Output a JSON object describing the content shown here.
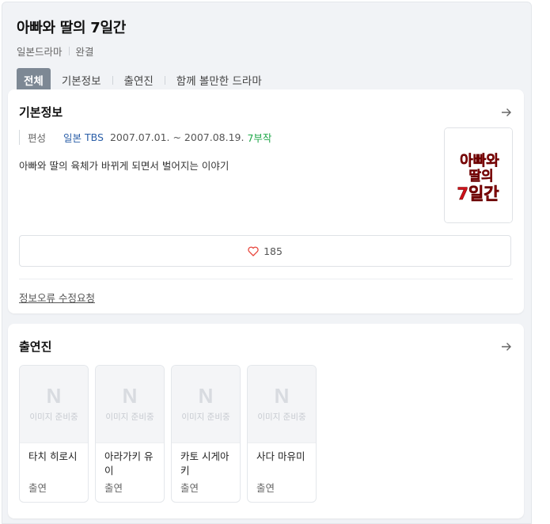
{
  "drama": {
    "title": "아빠와 딸의 7일간",
    "genre": "일본드라마",
    "status": "완결"
  },
  "tabs": [
    "전체",
    "기본정보",
    "출연진",
    "함께 볼만한 드라마"
  ],
  "basic_info": {
    "heading": "기본정보",
    "label": "편성",
    "country": "일본",
    "channel": "TBS",
    "dates": "2007.07.01. ~ 2007.08.19.",
    "episodes": "7부작",
    "description": "아빠와 딸의 육체가 바뀌게 되면서 벌어지는 이야기",
    "poster_text": [
      "아빠와",
      "딸의",
      "7일간"
    ],
    "likes": "185",
    "report_link": "정보오류 수정요청"
  },
  "cast": {
    "heading": "출연진",
    "placeholder_logo": "N",
    "placeholder_text": "이미지 준비중",
    "members": [
      {
        "name": "타치 히로시",
        "role": "출연"
      },
      {
        "name": "아라가키 유이",
        "role": "출연"
      },
      {
        "name": "카토 시게아키",
        "role": "출연"
      },
      {
        "name": "사다 마유미",
        "role": "출연"
      }
    ]
  },
  "colors": {
    "active_tab": "#7d8894",
    "channel": "#2b5fa8",
    "episodes": "#20a84a",
    "poster_text": "#d0121b",
    "heart": "#e8453c"
  },
  "icons": [
    "arrow-right-icon",
    "heart-icon",
    "n-logo-icon"
  ]
}
